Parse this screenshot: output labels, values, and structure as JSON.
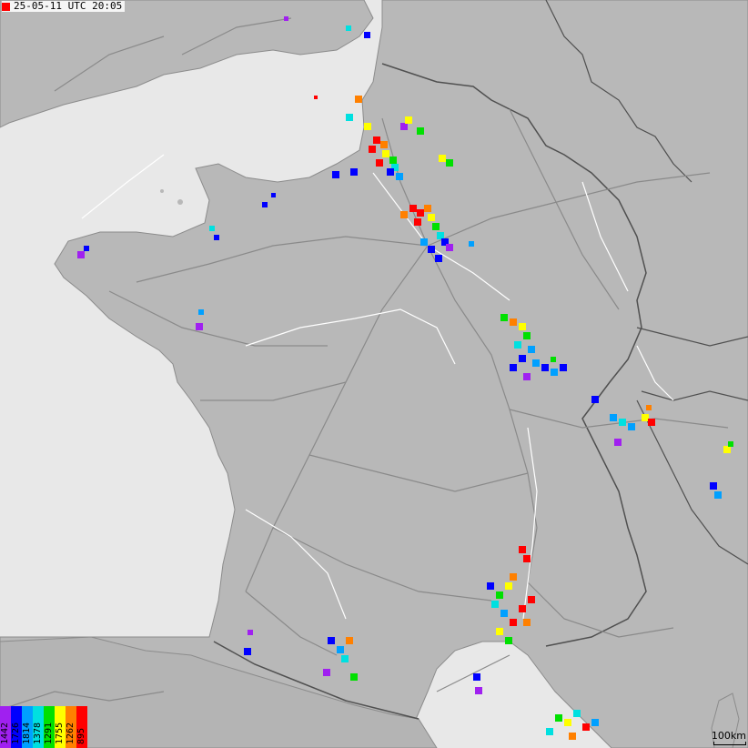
{
  "timestamp": "25-05-11 UTC 20:05",
  "scale_label": "100km",
  "colors": {
    "sea": "#e8e8e8",
    "land": "#b8b8b8",
    "border": "#505050",
    "road": "#8a8a8a",
    "river": "#ffffff"
  },
  "legend": [
    {
      "label": "1442",
      "color": "#a020f0"
    },
    {
      "label": "1726",
      "color": "#0000ff"
    },
    {
      "label": "1814",
      "color": "#00a0ff"
    },
    {
      "label": "1378",
      "color": "#00e0e0"
    },
    {
      "label": "1291",
      "color": "#00e000"
    },
    {
      "label": "1755",
      "color": "#ffff00"
    },
    {
      "label": "1262",
      "color": "#ff8000"
    },
    {
      "label": "895",
      "color": "#ff0000"
    }
  ]
}
